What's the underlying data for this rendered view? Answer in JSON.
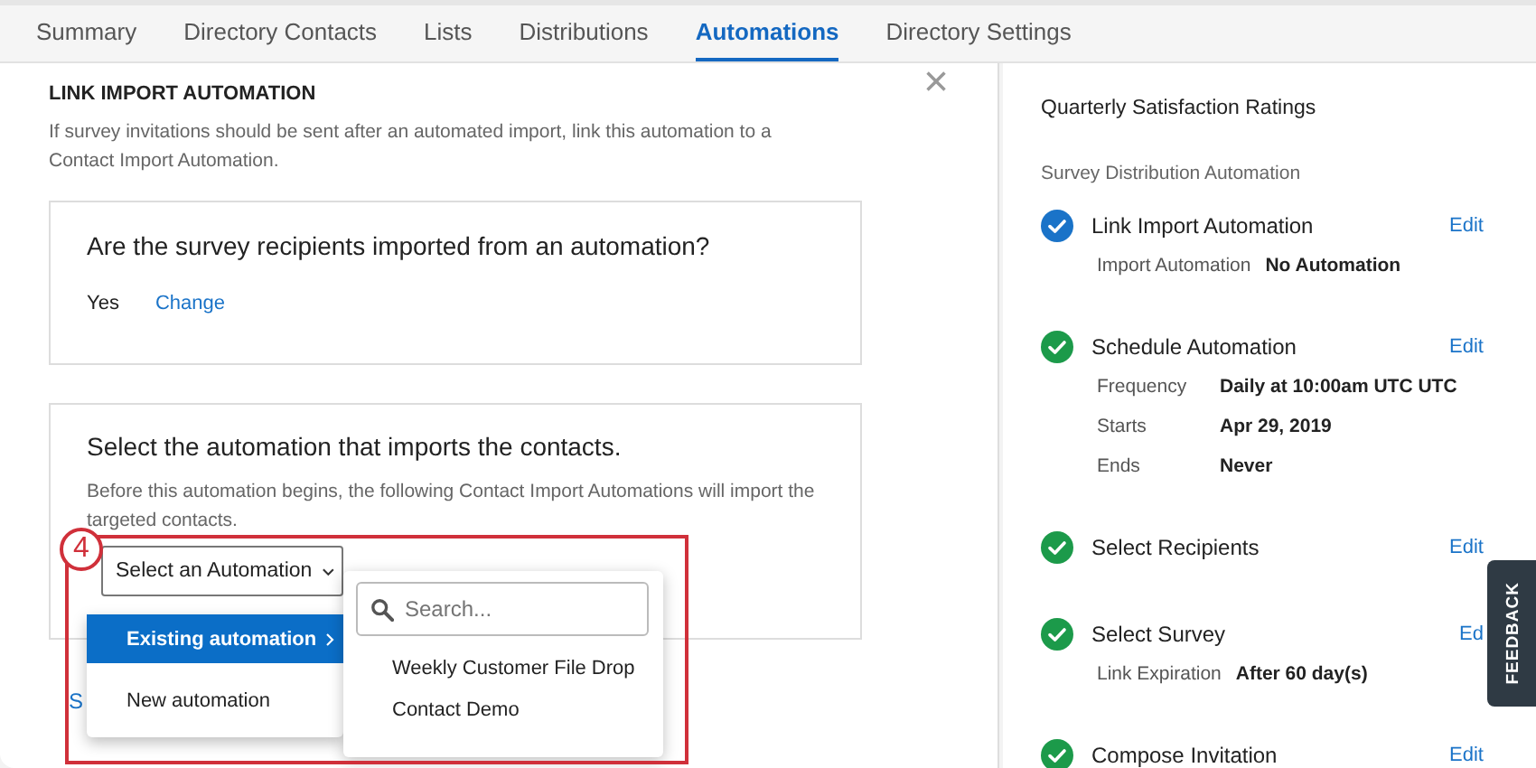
{
  "tabs": [
    {
      "label": "Summary",
      "selected": false
    },
    {
      "label": "Directory Contacts",
      "selected": false
    },
    {
      "label": "Lists",
      "selected": false
    },
    {
      "label": "Distributions",
      "selected": false
    },
    {
      "label": "Automations",
      "selected": true
    },
    {
      "label": "Directory Settings",
      "selected": false
    }
  ],
  "panel": {
    "heading": "LINK IMPORT AUTOMATION",
    "close": "×",
    "description": "If survey invitations should be sent after an automated import, link this automation to a Contact Import Automation.",
    "question_card": {
      "question": "Are the survey recipients imported from an automation?",
      "answer": "Yes",
      "change_link": "Change"
    },
    "select_card": {
      "title": "Select the automation that imports the contacts.",
      "description": "Before this automation begins, the following Contact Import Automations will import the targeted contacts.",
      "dropdown": "Select an Automation"
    },
    "hidden_link": "S",
    "menu": [
      {
        "label": "Existing automation",
        "selected": true,
        "submenu": true
      },
      {
        "label": "New automation",
        "selected": false,
        "submenu": false
      }
    ],
    "submenu": {
      "search": {
        "placeholder": "Search..."
      },
      "items": [
        "Weekly Customer File Drop",
        "Contact Demo"
      ]
    },
    "callout": {
      "number": "4"
    }
  },
  "sidebar": {
    "title": "Quarterly Satisfaction Ratings",
    "subtitle": "Survey Distribution Automation",
    "steps": [
      {
        "title": "Link Import Automation",
        "current": true,
        "edit": "Edit",
        "details": [
          {
            "label": "Import Automation",
            "value": "No Automation"
          }
        ]
      },
      {
        "title": "Schedule Automation",
        "current": false,
        "edit": "Edit",
        "details": [
          {
            "label": "Frequency",
            "value": "Daily at 10:00am UTC UTC"
          },
          {
            "label": "Starts",
            "value": "Apr 29, 2019"
          },
          {
            "label": "Ends",
            "value": "Never"
          }
        ]
      },
      {
        "title": "Select Recipients",
        "current": false,
        "edit": "Edit"
      },
      {
        "title": "Select Survey",
        "current": false,
        "edit": "Ed",
        "details": [
          {
            "label": "Link Expiration",
            "value": "After 60 day(s)"
          }
        ]
      },
      {
        "title": "Compose Invitation",
        "current": false,
        "edit": "Edit"
      }
    ]
  },
  "feedback": "FEEDBACK"
}
